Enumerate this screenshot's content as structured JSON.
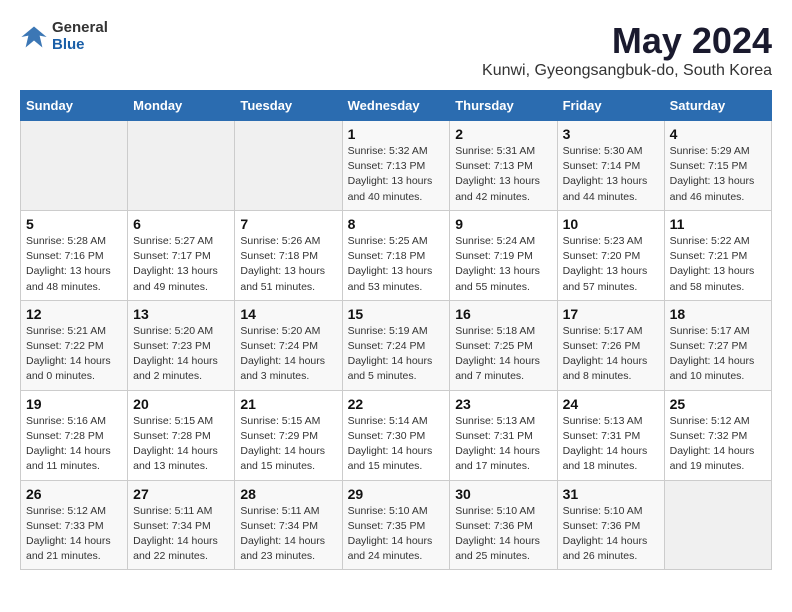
{
  "header": {
    "logo_general": "General",
    "logo_blue": "Blue",
    "month": "May 2024",
    "location": "Kunwi, Gyeongsangbuk-do, South Korea"
  },
  "weekdays": [
    "Sunday",
    "Monday",
    "Tuesday",
    "Wednesday",
    "Thursday",
    "Friday",
    "Saturday"
  ],
  "weeks": [
    [
      {
        "day": "",
        "info": ""
      },
      {
        "day": "",
        "info": ""
      },
      {
        "day": "",
        "info": ""
      },
      {
        "day": "1",
        "info": "Sunrise: 5:32 AM\nSunset: 7:13 PM\nDaylight: 13 hours\nand 40 minutes."
      },
      {
        "day": "2",
        "info": "Sunrise: 5:31 AM\nSunset: 7:13 PM\nDaylight: 13 hours\nand 42 minutes."
      },
      {
        "day": "3",
        "info": "Sunrise: 5:30 AM\nSunset: 7:14 PM\nDaylight: 13 hours\nand 44 minutes."
      },
      {
        "day": "4",
        "info": "Sunrise: 5:29 AM\nSunset: 7:15 PM\nDaylight: 13 hours\nand 46 minutes."
      }
    ],
    [
      {
        "day": "5",
        "info": "Sunrise: 5:28 AM\nSunset: 7:16 PM\nDaylight: 13 hours\nand 48 minutes."
      },
      {
        "day": "6",
        "info": "Sunrise: 5:27 AM\nSunset: 7:17 PM\nDaylight: 13 hours\nand 49 minutes."
      },
      {
        "day": "7",
        "info": "Sunrise: 5:26 AM\nSunset: 7:18 PM\nDaylight: 13 hours\nand 51 minutes."
      },
      {
        "day": "8",
        "info": "Sunrise: 5:25 AM\nSunset: 7:18 PM\nDaylight: 13 hours\nand 53 minutes."
      },
      {
        "day": "9",
        "info": "Sunrise: 5:24 AM\nSunset: 7:19 PM\nDaylight: 13 hours\nand 55 minutes."
      },
      {
        "day": "10",
        "info": "Sunrise: 5:23 AM\nSunset: 7:20 PM\nDaylight: 13 hours\nand 57 minutes."
      },
      {
        "day": "11",
        "info": "Sunrise: 5:22 AM\nSunset: 7:21 PM\nDaylight: 13 hours\nand 58 minutes."
      }
    ],
    [
      {
        "day": "12",
        "info": "Sunrise: 5:21 AM\nSunset: 7:22 PM\nDaylight: 14 hours\nand 0 minutes."
      },
      {
        "day": "13",
        "info": "Sunrise: 5:20 AM\nSunset: 7:23 PM\nDaylight: 14 hours\nand 2 minutes."
      },
      {
        "day": "14",
        "info": "Sunrise: 5:20 AM\nSunset: 7:24 PM\nDaylight: 14 hours\nand 3 minutes."
      },
      {
        "day": "15",
        "info": "Sunrise: 5:19 AM\nSunset: 7:24 PM\nDaylight: 14 hours\nand 5 minutes."
      },
      {
        "day": "16",
        "info": "Sunrise: 5:18 AM\nSunset: 7:25 PM\nDaylight: 14 hours\nand 7 minutes."
      },
      {
        "day": "17",
        "info": "Sunrise: 5:17 AM\nSunset: 7:26 PM\nDaylight: 14 hours\nand 8 minutes."
      },
      {
        "day": "18",
        "info": "Sunrise: 5:17 AM\nSunset: 7:27 PM\nDaylight: 14 hours\nand 10 minutes."
      }
    ],
    [
      {
        "day": "19",
        "info": "Sunrise: 5:16 AM\nSunset: 7:28 PM\nDaylight: 14 hours\nand 11 minutes."
      },
      {
        "day": "20",
        "info": "Sunrise: 5:15 AM\nSunset: 7:28 PM\nDaylight: 14 hours\nand 13 minutes."
      },
      {
        "day": "21",
        "info": "Sunrise: 5:15 AM\nSunset: 7:29 PM\nDaylight: 14 hours\nand 15 minutes."
      },
      {
        "day": "22",
        "info": "Sunrise: 5:14 AM\nSunset: 7:30 PM\nDaylight: 14 hours\nand 15 minutes."
      },
      {
        "day": "23",
        "info": "Sunrise: 5:13 AM\nSunset: 7:31 PM\nDaylight: 14 hours\nand 17 minutes."
      },
      {
        "day": "24",
        "info": "Sunrise: 5:13 AM\nSunset: 7:31 PM\nDaylight: 14 hours\nand 18 minutes."
      },
      {
        "day": "25",
        "info": "Sunrise: 5:12 AM\nSunset: 7:32 PM\nDaylight: 14 hours\nand 19 minutes."
      }
    ],
    [
      {
        "day": "26",
        "info": "Sunrise: 5:12 AM\nSunset: 7:33 PM\nDaylight: 14 hours\nand 21 minutes."
      },
      {
        "day": "27",
        "info": "Sunrise: 5:11 AM\nSunset: 7:34 PM\nDaylight: 14 hours\nand 22 minutes."
      },
      {
        "day": "28",
        "info": "Sunrise: 5:11 AM\nSunset: 7:34 PM\nDaylight: 14 hours\nand 23 minutes."
      },
      {
        "day": "29",
        "info": "Sunrise: 5:10 AM\nSunset: 7:35 PM\nDaylight: 14 hours\nand 24 minutes."
      },
      {
        "day": "30",
        "info": "Sunrise: 5:10 AM\nSunset: 7:36 PM\nDaylight: 14 hours\nand 25 minutes."
      },
      {
        "day": "31",
        "info": "Sunrise: 5:10 AM\nSunset: 7:36 PM\nDaylight: 14 hours\nand 26 minutes."
      },
      {
        "day": "",
        "info": ""
      }
    ]
  ]
}
